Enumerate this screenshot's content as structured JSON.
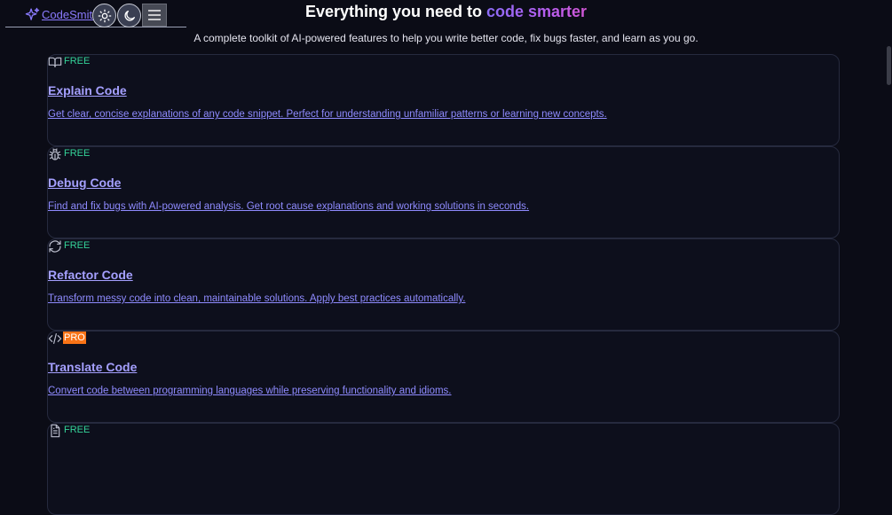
{
  "nav": {
    "logo_text": "CodeSmith",
    "light_theme_label": "light theme",
    "dark_theme_label": "dark theme",
    "menu_label": "menu"
  },
  "hero": {
    "title_prefix": "Everything you need to ",
    "title_highlight": "code smarter",
    "subtitle": "A complete toolkit of AI-powered features to help you write better code, fix bugs faster, and learn as you go."
  },
  "features": [
    {
      "icon": "book-open-icon",
      "badge": "FREE",
      "title": "Explain Code",
      "description": "Get clear, concise explanations of any code snippet. Perfect for understanding unfamiliar patterns or learning new concepts."
    },
    {
      "icon": "bug-icon",
      "badge": "FREE",
      "title": "Debug Code",
      "description": "Find and fix bugs with AI-powered analysis. Get root cause explanations and working solutions in seconds."
    },
    {
      "icon": "refresh-icon",
      "badge": "FREE",
      "title": "Refactor Code",
      "description": "Transform messy code into clean, maintainable solutions. Apply best practices automatically."
    },
    {
      "icon": "code-icon",
      "badge": "PRO",
      "title": "Translate Code",
      "description": "Convert code between programming languages while preserving functionality and idioms."
    },
    {
      "icon": "document-icon",
      "badge": "FREE",
      "title": "",
      "description": ""
    }
  ],
  "colors": {
    "background": "#0b0c16",
    "accent": "#8b7bff",
    "free_badge": "#34d399",
    "pro_badge": "#f97316"
  }
}
